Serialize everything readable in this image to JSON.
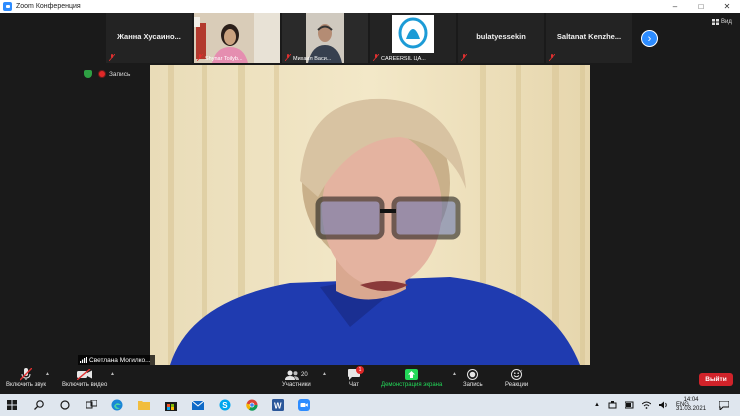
{
  "window": {
    "title": "Zoom Конференция"
  },
  "strip": {
    "tiles": [
      {
        "name": "Жанна  Хусаино...",
        "label": ""
      },
      {
        "name": "",
        "label": "Shynar Toilyb..."
      },
      {
        "name": "",
        "label": "Михаил Васи..."
      },
      {
        "name": "",
        "label": "CAREERSIL ЦА..."
      },
      {
        "name": "bulatyessekin",
        "label": ""
      },
      {
        "name": "Saltanat  Kenzhe...",
        "label": ""
      }
    ],
    "view_label": "Вид"
  },
  "status": {
    "record_label": "Запись"
  },
  "speaker": {
    "name": "Светлана Могилко..."
  },
  "toolbar": {
    "audio_label": "Включить звук",
    "video_label": "Включить видео",
    "participants_label": "Участники",
    "participants_count": "20",
    "chat_label": "Чат",
    "chat_badge": "1",
    "share_label": "Демонстрация экрана",
    "record_label": "Запись",
    "reactions_label": "Реакции",
    "leave_label": "Выйти"
  },
  "taskbar": {
    "lang": "ENG",
    "time": "14:04",
    "date": "31.03.2021"
  },
  "colors": {
    "zoom_blue": "#2d8cff",
    "leave_red": "#d1232a",
    "share_green": "#23d959",
    "background": "#1a1a1a"
  }
}
